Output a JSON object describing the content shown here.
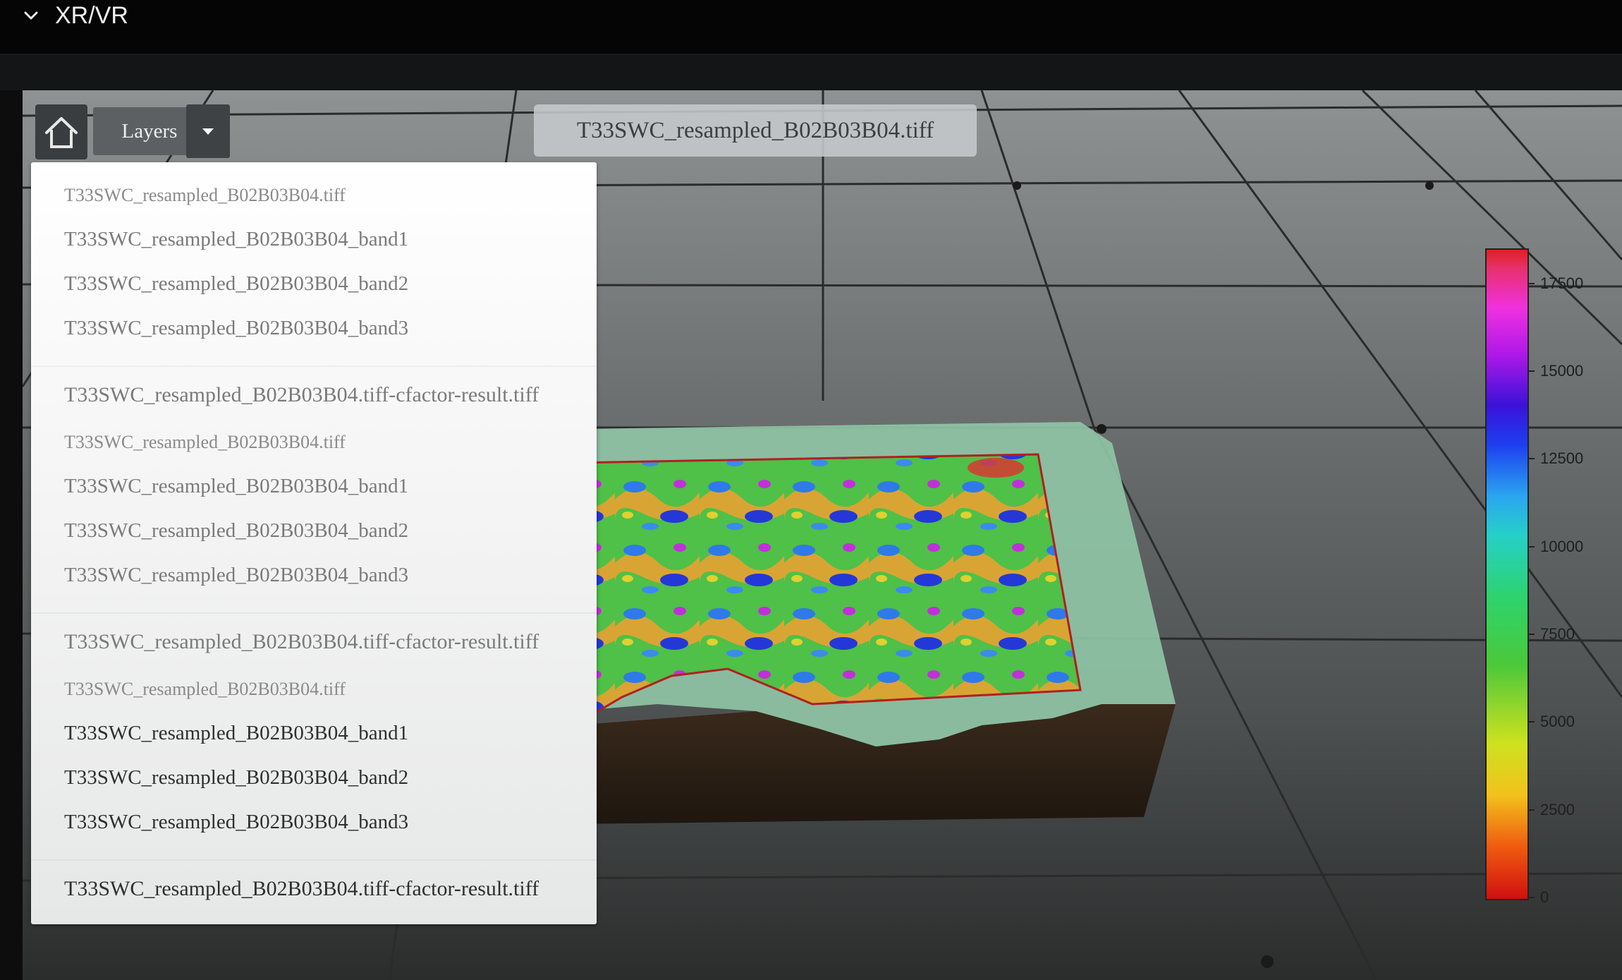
{
  "header": {
    "title": "XR/VR",
    "collapse_icon": "chevron-down-icon"
  },
  "toolbar": {
    "home_icon": "home-icon",
    "layers_label": "Layers",
    "dropdown_icon": "caret-down-icon"
  },
  "active_layer": "T33SWC_resampled_B02B03B04.tiff",
  "layer_menu": {
    "groups": [
      {
        "name": "T33SWC_resampled_B02B03B04.tiff",
        "bands": [
          "T33SWC_resampled_B02B03B04_band1",
          "T33SWC_resampled_B02B03B04_band2",
          "T33SWC_resampled_B02B03B04_band3"
        ],
        "result": "T33SWC_resampled_B02B03B04.tiff-cfactor-result.tiff"
      },
      {
        "name": "T33SWC_resampled_B02B03B04.tiff",
        "bands": [
          "T33SWC_resampled_B02B03B04_band1",
          "T33SWC_resampled_B02B03B04_band2",
          "T33SWC_resampled_B02B03B04_band3"
        ],
        "result": "T33SWC_resampled_B02B03B04.tiff-cfactor-result.tiff"
      },
      {
        "name": "T33SWC_resampled_B02B03B04.tiff",
        "bands": [
          "T33SWC_resampled_B02B03B04_band1",
          "T33SWC_resampled_B02B03B04_band2",
          "T33SWC_resampled_B02B03B04_band3"
        ],
        "result": "T33SWC_resampled_B02B03B04.tiff-cfactor-result.tiff"
      }
    ]
  },
  "colorbar": {
    "min": 0,
    "max": 18500,
    "ticks": [
      "0",
      "2500",
      "5000",
      "7500",
      "10000",
      "12500",
      "15000",
      "17500"
    ],
    "colormap": [
      "#d01010",
      "#f2c21c",
      "#4cc83a",
      "#26d0c8",
      "#1e3ef0",
      "#b018e8",
      "#f030e0",
      "#e02020"
    ]
  }
}
